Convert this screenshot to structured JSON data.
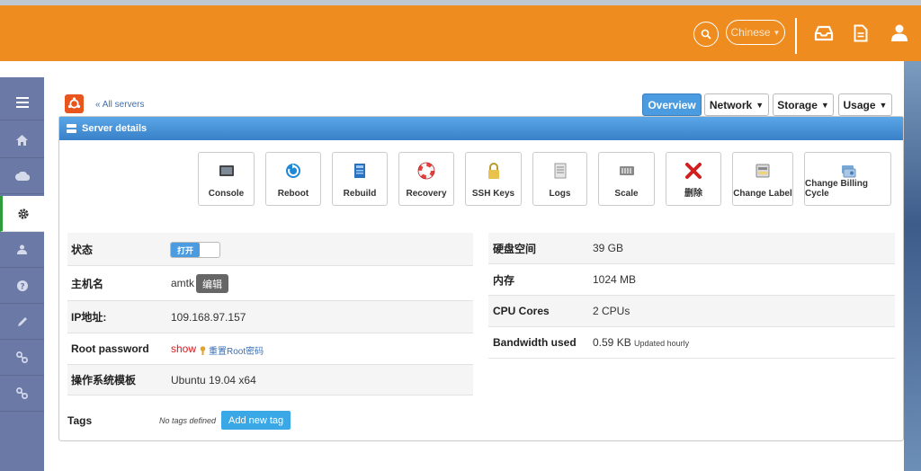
{
  "header": {
    "language": "Chinese"
  },
  "colors": {
    "topbar": "#ef8c1f",
    "sidebar": "#6b79a6",
    "accent": "#4a9be0",
    "danger": "#e0161a"
  },
  "sidebar": {
    "items": [
      {
        "name": "menu",
        "icon": "menu-icon"
      },
      {
        "name": "home",
        "icon": "home-icon"
      },
      {
        "name": "cloud",
        "icon": "cloud-icon"
      },
      {
        "name": "settings",
        "icon": "gear-icon",
        "active": true
      },
      {
        "name": "user",
        "icon": "user-icon"
      },
      {
        "name": "help",
        "icon": "help-icon"
      },
      {
        "name": "edit",
        "icon": "pencil-icon"
      },
      {
        "name": "link1",
        "icon": "link-icon"
      },
      {
        "name": "link2",
        "icon": "link-icon"
      }
    ]
  },
  "breadcrumb": {
    "back_label": "« All servers"
  },
  "tabs": {
    "overview": "Overview",
    "network": "Network",
    "storage": "Storage",
    "usage": "Usage"
  },
  "panel": {
    "title": "Server details"
  },
  "actions": {
    "console": "Console",
    "reboot": "Reboot",
    "rebuild": "Rebuild",
    "recovery": "Recovery",
    "ssh_keys": "SSH Keys",
    "logs": "Logs",
    "scale": "Scale",
    "delete": "删除",
    "change_label": "Change Label",
    "change_billing": "Change Billing Cycle"
  },
  "details_left": {
    "status_label": "状态",
    "status_toggle": "打开",
    "hostname_label": "主机名",
    "hostname_value": "amtk",
    "edit_button": "编辑",
    "ip_label": "IP地址:",
    "ip_value": "109.168.97.157",
    "root_password_label": "Root password",
    "root_password_show": "show",
    "reset_root_label": "重置Root密码",
    "os_template_label": "操作系统模板",
    "os_template_value": "Ubuntu 19.04 x64"
  },
  "details_right": {
    "disk_label": "硬盘空间",
    "disk_value": "39 GB",
    "memory_label": "内存",
    "memory_value": "1024 MB",
    "cpu_label": "CPU Cores",
    "cpu_value": "2 CPUs",
    "bandwidth_label": "Bandwidth used",
    "bandwidth_value": "0.59 KB",
    "bandwidth_note": "Updated hourly"
  },
  "tags": {
    "label": "Tags",
    "empty_text": "No tags defined",
    "add_button": "Add new tag"
  }
}
